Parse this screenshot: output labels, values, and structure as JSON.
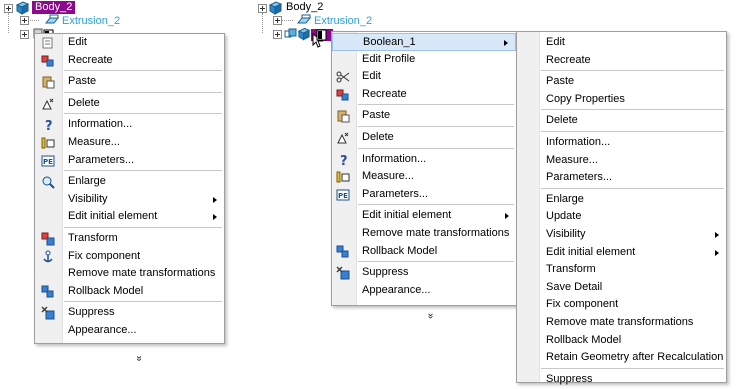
{
  "left": {
    "tree": {
      "body": "Body_2",
      "extrusion": "Extrusion_2"
    },
    "menu": [
      {
        "label": "Edit",
        "icon": "edit-icon"
      },
      {
        "label": "Recreate",
        "icon": "recreate-icon"
      },
      {
        "sep": true
      },
      {
        "label": "Paste",
        "icon": "paste-icon"
      },
      {
        "sep": true
      },
      {
        "label": "Delete",
        "icon": "delete-icon"
      },
      {
        "sep": true
      },
      {
        "label": "Information...",
        "icon": "information-icon"
      },
      {
        "label": "Measure...",
        "icon": "measure-icon"
      },
      {
        "label": "Parameters...",
        "icon": "parameters-icon"
      },
      {
        "sep": true
      },
      {
        "label": "Enlarge",
        "icon": "enlarge-icon"
      },
      {
        "label": "Visibility",
        "submenu": true
      },
      {
        "label": "Edit initial element",
        "submenu": true
      },
      {
        "sep": true
      },
      {
        "label": "Transform",
        "icon": "transform-icon"
      },
      {
        "label": "Fix component",
        "icon": "fix-component-icon"
      },
      {
        "label": "Remove mate transformations"
      },
      {
        "label": "Rollback Model",
        "icon": "rollback-icon"
      },
      {
        "sep": true
      },
      {
        "label": "Suppress",
        "icon": "suppress-icon"
      },
      {
        "label": "Appearance..."
      }
    ],
    "more": "»"
  },
  "right": {
    "tree": {
      "body": "Body_2",
      "extrusion": "Extrusion_2"
    },
    "menu1": [
      {
        "label": "Boolean_1",
        "submenu": true,
        "highlighted": true
      },
      {
        "label": "Edit Profile"
      },
      {
        "label": "Edit",
        "icon": "scissors-icon"
      },
      {
        "label": "Recreate",
        "icon": "recreate-icon"
      },
      {
        "sep": true
      },
      {
        "label": "Paste",
        "icon": "paste-icon"
      },
      {
        "sep": true
      },
      {
        "label": "Delete",
        "icon": "delete-icon"
      },
      {
        "sep": true
      },
      {
        "label": "Information...",
        "icon": "information-icon"
      },
      {
        "label": "Measure...",
        "icon": "measure-icon"
      },
      {
        "label": "Parameters...",
        "icon": "parameters-icon"
      },
      {
        "sep": true
      },
      {
        "label": "Edit initial element",
        "submenu": true
      },
      {
        "label": "Remove mate transformations"
      },
      {
        "label": "Rollback Model",
        "icon": "rollback-icon"
      },
      {
        "sep": true
      },
      {
        "label": "Suppress",
        "icon": "suppress-icon"
      },
      {
        "label": "Appearance..."
      }
    ],
    "more": "»",
    "menu2": [
      {
        "label": "Edit"
      },
      {
        "label": "Recreate"
      },
      {
        "sep": true
      },
      {
        "label": "Paste"
      },
      {
        "label": "Copy Properties"
      },
      {
        "sep": true
      },
      {
        "label": "Delete"
      },
      {
        "sep": true
      },
      {
        "label": "Information..."
      },
      {
        "label": "Measure..."
      },
      {
        "label": "Parameters..."
      },
      {
        "sep": true
      },
      {
        "label": "Enlarge"
      },
      {
        "label": "Update"
      },
      {
        "label": "Visibility",
        "submenu": true
      },
      {
        "label": "Edit initial element",
        "submenu": true
      },
      {
        "label": "Transform"
      },
      {
        "label": "Save Detail"
      },
      {
        "label": "Fix component"
      },
      {
        "label": "Remove mate transformations"
      },
      {
        "label": "Rollback Model"
      },
      {
        "label": "Retain Geometry after Recalculation"
      },
      {
        "sep": true
      },
      {
        "label": "Suppress"
      }
    ]
  },
  "colors": {
    "body_highlight": "#8b0a8b",
    "extrusion_text": "#2aa0d8",
    "hover": "#d9e8f8"
  }
}
